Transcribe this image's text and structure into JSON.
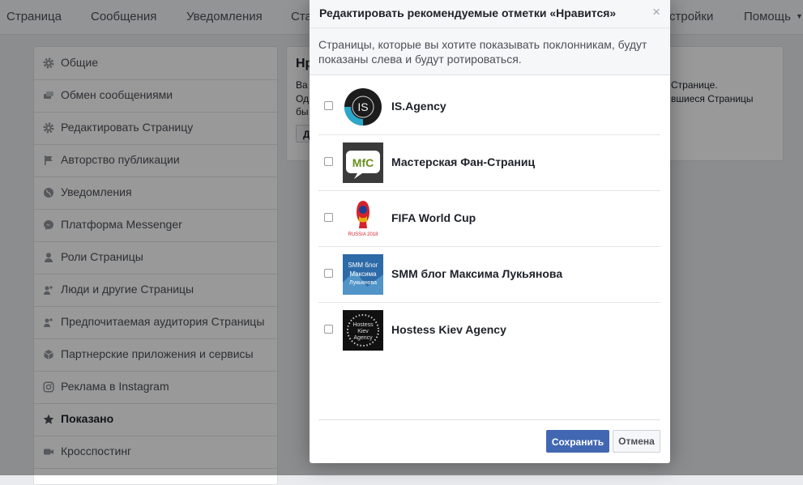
{
  "topnav": {
    "items": [
      "Страница",
      "Сообщения",
      "Уведомления",
      "Ста",
      "стройки",
      "Помощь"
    ]
  },
  "sidebar": {
    "items": [
      {
        "label": "Общие",
        "icon": "gear-icon"
      },
      {
        "label": "Обмен сообщениями",
        "icon": "chat-icon"
      },
      {
        "label": "Редактировать Страницу",
        "icon": "gear-icon"
      },
      {
        "label": "Авторство публикации",
        "icon": "flag-icon"
      },
      {
        "label": "Уведомления",
        "icon": "globe-icon"
      },
      {
        "label": "Платформа Messenger",
        "icon": "messenger-icon"
      },
      {
        "label": "Роли Страницы",
        "icon": "person-icon"
      },
      {
        "label": "Люди и другие Страницы",
        "icon": "people-icon"
      },
      {
        "label": "Предпочитаемая аудитория Страницы",
        "icon": "people-icon"
      },
      {
        "label": "Партнерские приложения и сервисы",
        "icon": "box-icon"
      },
      {
        "label": "Реклама в Instagram",
        "icon": "instagram-icon"
      },
      {
        "label": "Показано",
        "icon": "star-icon",
        "active": true
      },
      {
        "label": "Кросспостинг",
        "icon": "video-icon"
      }
    ]
  },
  "card": {
    "title": "Нр",
    "lines": [
      "Ва",
      "Од",
      "бы"
    ],
    "right_lines": [
      "Странице.",
      "вшиеся Страницы"
    ],
    "button": "Д"
  },
  "dialog": {
    "title": "Редактировать рекомендуемые отметки «Нравится»",
    "close": "×",
    "description_lines": [
      "Страницы, которые вы хотите показывать поклонникам, будут",
      "показаны слева и будут ротироваться."
    ],
    "pages": [
      {
        "name": "IS.Agency",
        "checked": false
      },
      {
        "name": "Мастерская Фан-Страниц",
        "checked": false
      },
      {
        "name": "FIFA World Cup",
        "checked": false
      },
      {
        "name": "SMM блог Максима Лукьянова",
        "checked": false
      },
      {
        "name": "Hostess Kiev Agency",
        "checked": false
      }
    ],
    "thumb_text": {
      "is_agency": "IS",
      "mfc": "MfC",
      "fifa": "RUSSIA 2018",
      "smm_1": "SMM блог",
      "smm_2": "Максима",
      "smm_3": "Лукьянова",
      "hostess_1": "Hostess",
      "hostess_2": "Kiev",
      "hostess_3": "Agency"
    },
    "save_label": "Сохранить",
    "cancel_label": "Отмена"
  },
  "colors": {
    "primary_button": "#4267b2",
    "overlay": "rgba(0,0,0,0.4)"
  }
}
